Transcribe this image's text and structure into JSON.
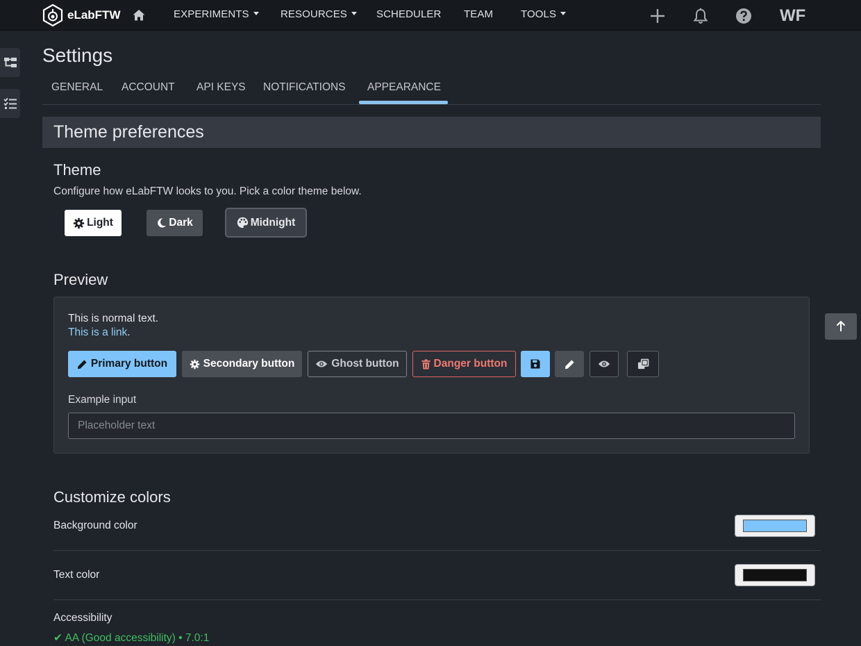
{
  "nav": {
    "brand": "eLabFTW",
    "items": [
      {
        "label": "EXPERIMENTS",
        "dropdown": true
      },
      {
        "label": "RESOURCES",
        "dropdown": true
      },
      {
        "label": "SCHEDULER",
        "dropdown": false
      },
      {
        "label": "TEAM",
        "dropdown": false
      },
      {
        "label": "TOOLS",
        "dropdown": true
      }
    ],
    "user_initials": "WF"
  },
  "page": {
    "title": "Settings",
    "tabs": [
      "GENERAL",
      "ACCOUNT",
      "API KEYS",
      "NOTIFICATIONS",
      "APPEARANCE"
    ],
    "active_tab": "APPEARANCE"
  },
  "theme_section": {
    "header": "Theme preferences",
    "subheading": "Theme",
    "description": "Configure how eLabFTW looks to you. Pick a color theme below.",
    "buttons": {
      "light": "Light",
      "dark": "Dark",
      "midnight": "Midnight"
    },
    "selected": "Midnight"
  },
  "preview": {
    "heading": "Preview",
    "normal_text": "This is normal text.",
    "link_text": "This is a link",
    "link_suffix": ".",
    "buttons": {
      "primary": "Primary button",
      "secondary": "Secondary button",
      "ghost": "Ghost button",
      "danger": "Danger button"
    },
    "input_label": "Example input",
    "input_placeholder": "Placeholder text"
  },
  "colors": {
    "heading": "Customize colors",
    "background_label": "Background color",
    "background_value": "#7ec4fa",
    "text_label": "Text color",
    "text_value": "#111111",
    "accessibility_label": "Accessibility",
    "accessibility_value": "✔ AA (Good accessibility) • 7.0:1"
  },
  "theme_colors": {
    "page_bg": "#1f232a",
    "nav_bg": "#16191e",
    "accent": "#8bc2ec",
    "primary": "#7ec4fa",
    "danger": "#e0685d",
    "success": "#3fbf5f"
  }
}
